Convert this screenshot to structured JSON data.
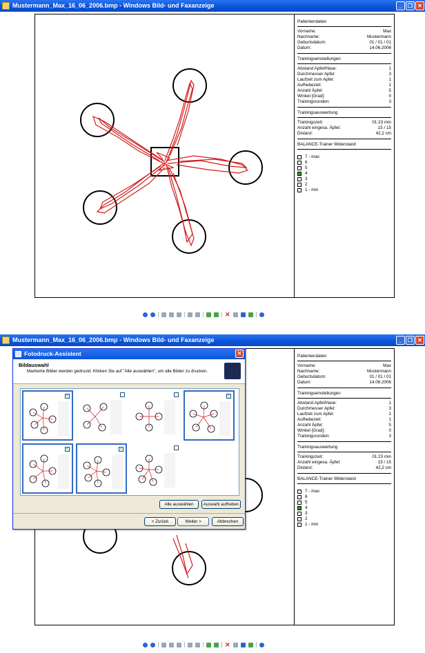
{
  "window_title": "Mustermann_Max_16_06_2006.bmp - Windows Bild- und Faxanzeige",
  "title_buttons": {
    "min": "_",
    "max": "❐",
    "close": "✕"
  },
  "panel": {
    "patient_header": "Patientendaten",
    "patient_rows": [
      {
        "label": "Vorname:",
        "value": "Max"
      },
      {
        "label": "Nachname:",
        "value": "Mustermann"
      },
      {
        "label": "Geburtsdatum:",
        "value": "01 / 01 / 01"
      },
      {
        "label": "Datum:",
        "value": "14.06.2006"
      }
    ],
    "settings_header": "Trainingseinstellungen",
    "settings_rows": [
      {
        "label": "Abstand Apfel/Hase:",
        "value": "1"
      },
      {
        "label": "Durchmesser Apfel:",
        "value": "3"
      },
      {
        "label": "Laufzeit zum Apfel:",
        "value": "1"
      },
      {
        "label": "Aufhebezeit:",
        "value": "1"
      },
      {
        "label": "Anzahl Äpfel:",
        "value": "5"
      },
      {
        "label": "Winkel [Grad]:",
        "value": "0"
      },
      {
        "label": "Trainingsrunden:",
        "value": "3"
      }
    ],
    "eval_header": "Trainingsauswertung",
    "eval_rows": [
      {
        "label": "Trainingszeit:",
        "value": "01:23 min"
      },
      {
        "label": "Anzahl eingesa. Äpfel:",
        "value": "15 / 15"
      },
      {
        "label": "Distanz:",
        "value": "42,2 cm"
      }
    ],
    "resistance_header": "BALANCE-Trainer Widerstand",
    "levels": [
      {
        "label": "7 - max",
        "checked": false
      },
      {
        "label": "6",
        "checked": false
      },
      {
        "label": "5",
        "checked": false
      },
      {
        "label": "4",
        "checked": true
      },
      {
        "label": "3",
        "checked": false
      },
      {
        "label": "2",
        "checked": false
      },
      {
        "label": "1 - min",
        "checked": false
      }
    ]
  },
  "dialog": {
    "title": "Fotodruck-Assistent",
    "close": "✕",
    "heading": "Bildauswahl",
    "instruction": "Markierte Bilder werden gedruckt. Klicken Sie auf \"Alle auswählen\", um alle Bilder zu drucken.",
    "thumbnails": [
      {
        "checked": true
      },
      {
        "checked": false
      },
      {
        "checked": false
      },
      {
        "checked": true
      },
      {
        "checked": true
      },
      {
        "checked": true
      },
      {
        "checked": false
      }
    ],
    "select_all": "Alle auswählen",
    "deselect": "Auswahl aufheben",
    "back": "< Zurück",
    "next": "Weiter >",
    "cancel": "Abbrechen"
  },
  "colors": {
    "trace": "#d21a1a",
    "titlebar": "#0b55d9",
    "selected_level": "#2ea02e"
  }
}
